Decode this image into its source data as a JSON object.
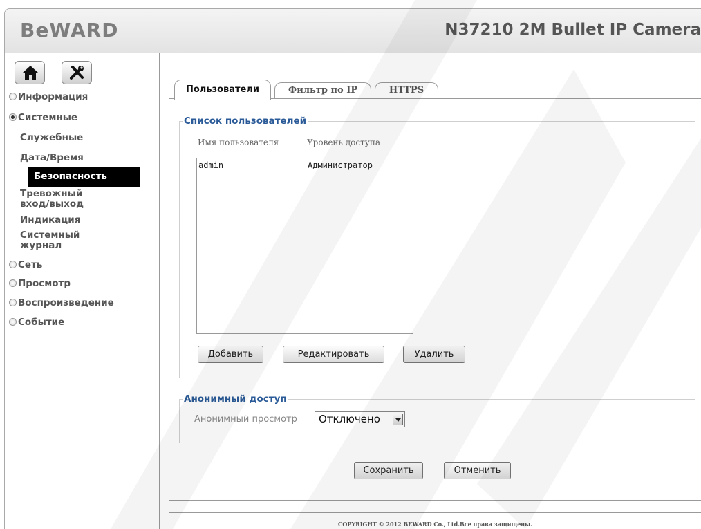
{
  "header": {
    "logo": "BeWARD",
    "model": "N37210 2M Bullet IP Camera"
  },
  "sidebar": {
    "home_icon": "home-icon",
    "tools_icon": "tools-icon",
    "groups": [
      {
        "label": "Информация",
        "expanded": false
      },
      {
        "label": "Системные",
        "expanded": true
      },
      {
        "label": "Сеть",
        "expanded": false
      },
      {
        "label": "Просмотр",
        "expanded": false
      },
      {
        "label": "Воспроизведение",
        "expanded": false
      },
      {
        "label": "Событие",
        "expanded": false
      }
    ],
    "subitems": [
      {
        "label": "Служебные"
      },
      {
        "label": "Дата/Время"
      },
      {
        "label": "Безопасность",
        "active": true
      },
      {
        "label": "Тревожный",
        "label2": "вход/выход"
      },
      {
        "label": "Индикация"
      },
      {
        "label": "Системный",
        "label2": "журнал"
      }
    ]
  },
  "tabs": [
    {
      "label": "Пользователи",
      "active": true
    },
    {
      "label": "Фильтр по IP"
    },
    {
      "label": "HTTPS"
    }
  ],
  "users": {
    "legend": "Список пользователей",
    "columns": [
      "Имя пользователя",
      "Уровень доступа"
    ],
    "rows": [
      {
        "name": "admin",
        "level": "Администратор"
      }
    ],
    "buttons": {
      "add": "Добавить",
      "edit": "Редактировать",
      "delete": "Удалить"
    }
  },
  "anonymous": {
    "legend": "Анонимный доступ",
    "label": "Анонимный просмотр",
    "value": "Отключено"
  },
  "actions": {
    "save": "Сохранить",
    "cancel": "Отменить"
  },
  "footer": "COPYRIGHT © 2012 BEWARD Co., Ltd.Все права защищены.",
  "colors": {
    "legend": "#2a5a97",
    "active_nav": "#000000"
  }
}
